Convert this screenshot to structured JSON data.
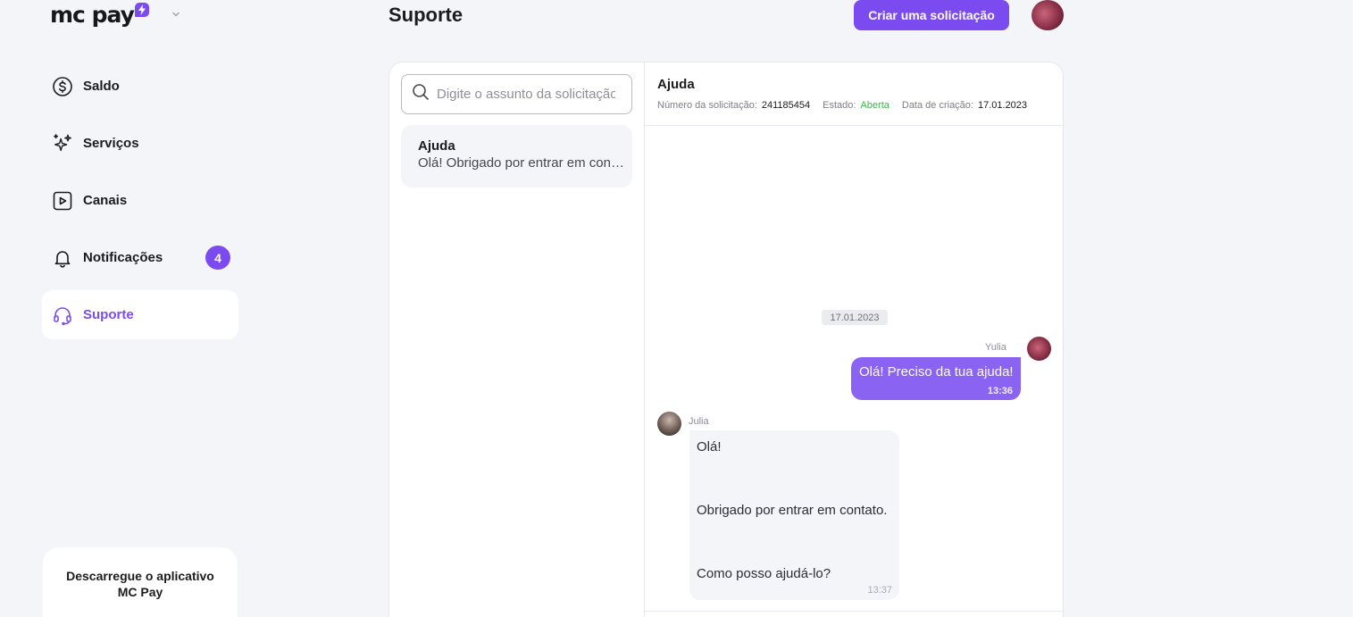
{
  "brand": {
    "name": "mc pay",
    "accent": "#7b4bf0"
  },
  "sidebar": {
    "items": [
      {
        "label": "Saldo",
        "icon": "dollar-circle-icon"
      },
      {
        "label": "Serviços",
        "icon": "sparkles-icon"
      },
      {
        "label": "Canais",
        "icon": "play-square-icon"
      },
      {
        "label": "Notificações",
        "icon": "bell-icon",
        "badge": "4"
      },
      {
        "label": "Suporte",
        "icon": "headset-icon",
        "active": true
      }
    ],
    "download": {
      "line1": "Descarregue o aplicativo",
      "line2": "MC Pay"
    }
  },
  "header": {
    "title": "Suporte",
    "create_button": "Criar uma solicitação"
  },
  "tickets": {
    "search_placeholder": "Digite o assunto da solicitação",
    "items": [
      {
        "title": "Ajuda",
        "preview": "Olá! Obrigado por entrar em contato."
      }
    ]
  },
  "chat": {
    "title": "Ajuda",
    "meta": {
      "number_label": "Número da solicitação:",
      "number_value": "241185454",
      "state_label": "Estado:",
      "state_value": "Aberta",
      "created_label": "Data de criação:",
      "created_value": "17.01.2023"
    },
    "date_divider": "17.01.2023",
    "messages": [
      {
        "sender": "Yulia",
        "text": "Olá! Preciso da tua ajuda!",
        "time": "13:36",
        "direction": "out"
      },
      {
        "sender": "Julia",
        "lines": [
          "Olá!",
          "Obrigado por entrar em contato.",
          "Como posso ajudá-lo?"
        ],
        "time": "13:37",
        "direction": "in"
      }
    ],
    "state_color": "#3bb54a"
  }
}
